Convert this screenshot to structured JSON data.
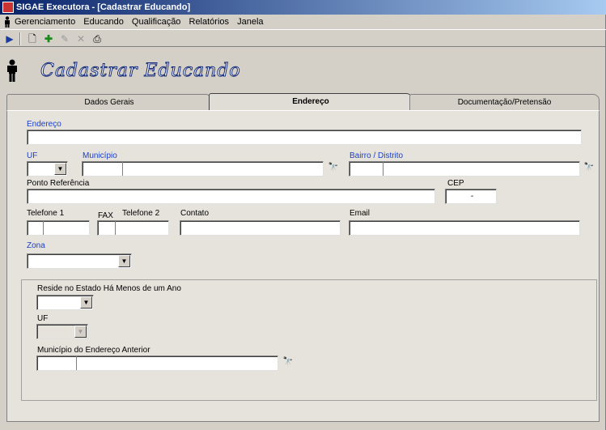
{
  "window": {
    "title": "SIGAE Executora - [Cadastrar Educando]"
  },
  "menu": {
    "items": [
      "Gerenciamento",
      "Educando",
      "Qualificação",
      "Relatórios",
      "Janela"
    ]
  },
  "page": {
    "title": "Cadastrar Educando"
  },
  "tabs": [
    {
      "label": "Dados Gerais",
      "active": false
    },
    {
      "label": "Endereço",
      "active": true
    },
    {
      "label": "Documentação/Pretensão",
      "active": false
    }
  ],
  "form": {
    "endereco": {
      "label": "Endereço",
      "value": ""
    },
    "uf": {
      "label": "UF",
      "value": ""
    },
    "municipio": {
      "label": "Município",
      "code": "",
      "value": ""
    },
    "bairro": {
      "label": "Bairro / Distrito",
      "code": "",
      "value": ""
    },
    "referencia": {
      "label": "Ponto Referência",
      "value": ""
    },
    "cep": {
      "label": "CEP",
      "value": "-"
    },
    "telefone1": {
      "label": "Telefone 1",
      "ddd": "",
      "value": ""
    },
    "fax": {
      "label": "FAX"
    },
    "telefone2": {
      "label": "Telefone 2",
      "ddd": "",
      "value": ""
    },
    "contato": {
      "label": "Contato",
      "value": ""
    },
    "email": {
      "label": "Email",
      "value": ""
    },
    "zona": {
      "label": "Zona",
      "value": ""
    }
  },
  "group": {
    "reside": {
      "label": "Reside no Estado Há Menos de um Ano",
      "value": ""
    },
    "uf_anterior": {
      "label": "UF",
      "value": ""
    },
    "municipio_anterior": {
      "label": "Município do Endereço Anterior",
      "code": "",
      "value": ""
    }
  },
  "colors": {
    "label_blue": "#1c40c8",
    "title_fill": "#ffffff",
    "title_stroke": "#1a2f7a"
  }
}
